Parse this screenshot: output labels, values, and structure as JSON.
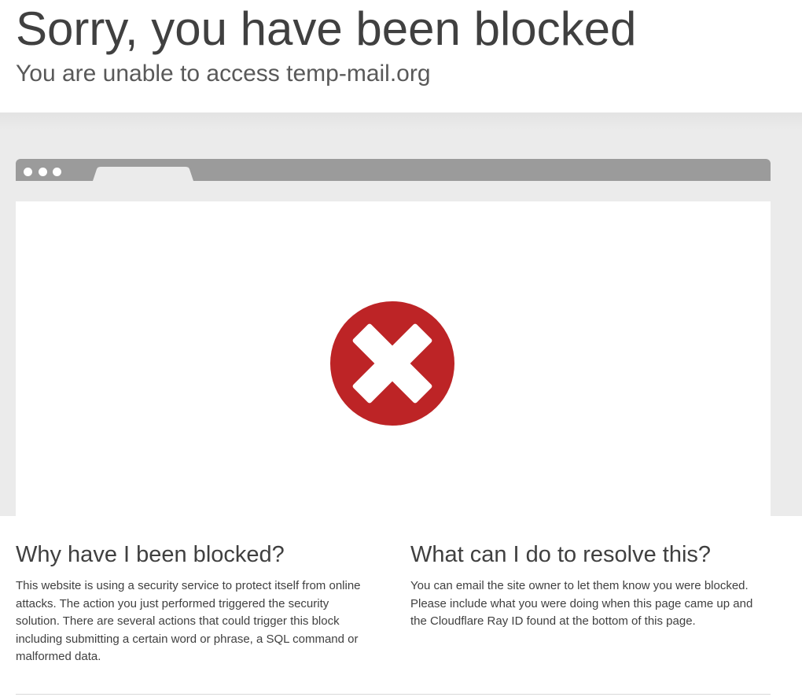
{
  "header": {
    "title": "Sorry, you have been blocked",
    "subtitle_prefix": "You are unable to access",
    "site": "temp-mail.org"
  },
  "illustration": {
    "icon": "error-x-icon",
    "icon_color": "#bd2426",
    "browser_bar_color": "#9b9b9b"
  },
  "why": {
    "heading": "Why have I been blocked?",
    "body": "This website is using a security service to protect itself from online attacks. The action you just performed triggered the security solution. There are several actions that could trigger this block including submitting a certain word or phrase, a SQL command or malformed data."
  },
  "resolve": {
    "heading": "What can I do to resolve this?",
    "body": "You can email the site owner to let them know you were blocked. Please include what you were doing when this page came up and the Cloudflare Ray ID found at the bottom of this page."
  }
}
